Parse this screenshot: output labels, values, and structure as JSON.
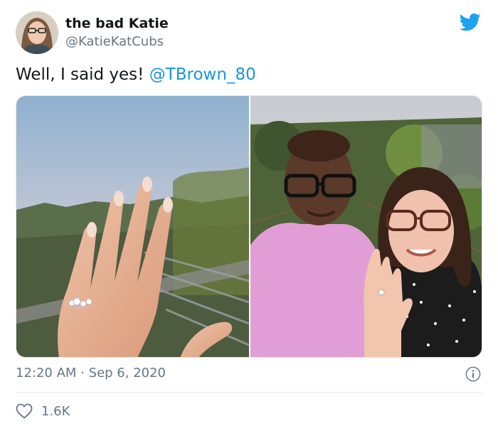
{
  "user": {
    "display_name": "the bad Katie",
    "handle": "@KatieKatCubs",
    "avatar_icon": "avatar-photo"
  },
  "tweet": {
    "text": "Well, I said yes!",
    "mention": "@TBrown_80"
  },
  "media": [
    {
      "icon": "ring-hand-photo"
    },
    {
      "icon": "couple-photo"
    }
  ],
  "meta": {
    "time": "12:20 AM",
    "separator": "·",
    "date": "Sep 6, 2020"
  },
  "engagement": {
    "likes": "1.6K"
  },
  "colors": {
    "brand": "#1da1f2",
    "link": "#1b95e0",
    "secondary_text": "#657786",
    "border": "#e1e8ed"
  }
}
